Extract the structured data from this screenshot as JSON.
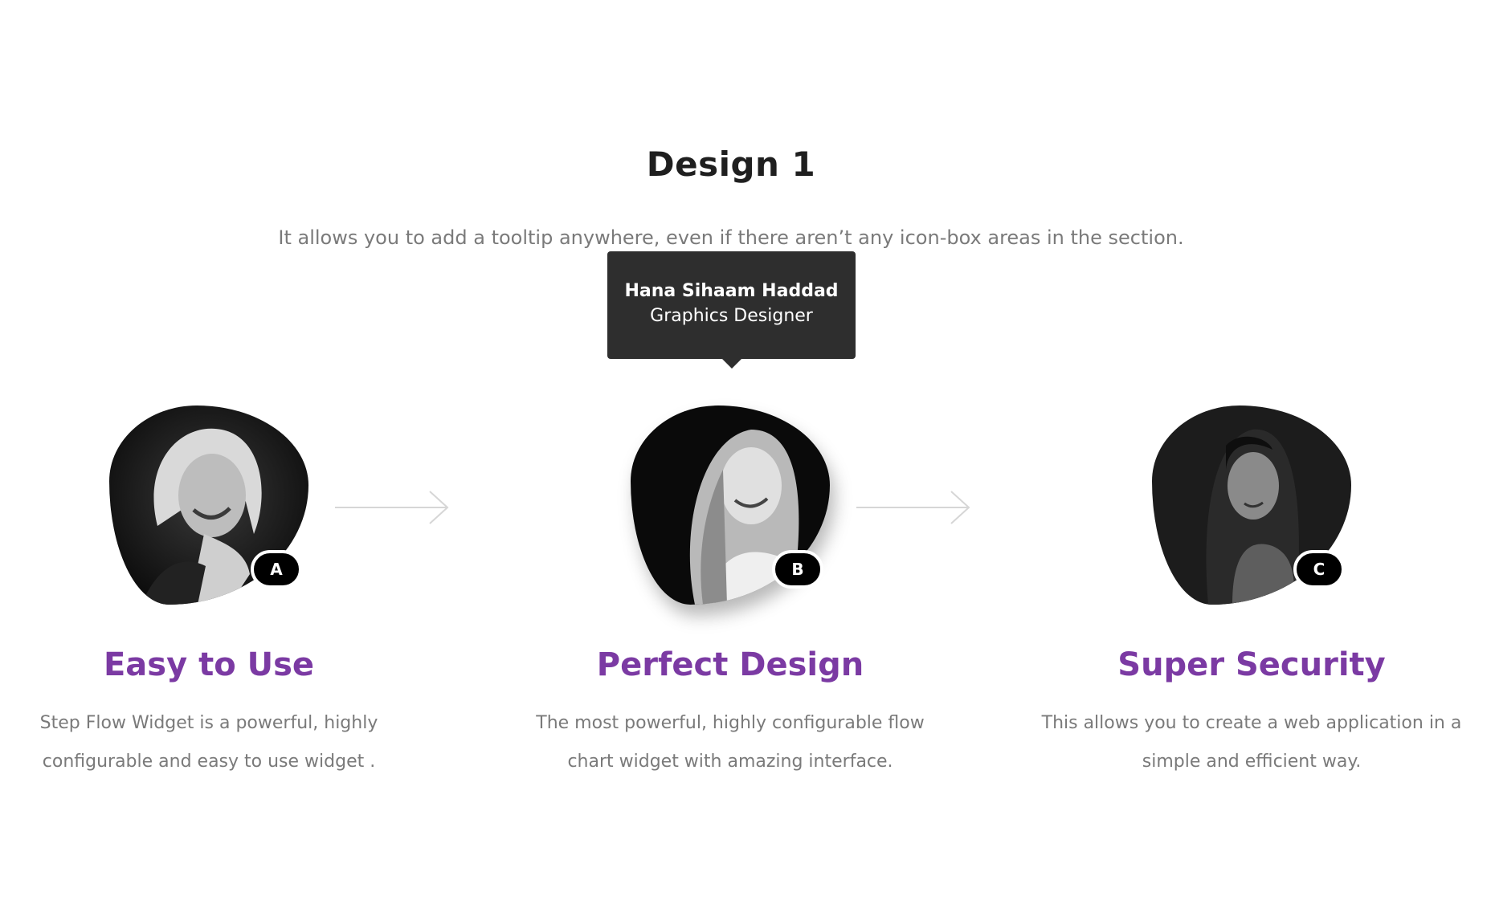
{
  "section": {
    "title": "Design 1",
    "subtitle": "It allows you to add a tooltip anywhere, even if there aren’t any icon-box areas in the section."
  },
  "tooltip": {
    "name": "Hana Sihaam Haddad",
    "role": "Graphics Designer"
  },
  "steps": [
    {
      "badge": "A",
      "title": "Easy to Use",
      "description": "Step Flow Widget is a powerful, highly configurable and easy to use widget ."
    },
    {
      "badge": "B",
      "title": "Perfect Design",
      "description": "The most powerful, highly configurable flow chart widget with amazing interface."
    },
    {
      "badge": "C",
      "title": "Super Security",
      "description": "This allows you to create a web application in a simple and efficient way."
    }
  ],
  "icons": {
    "connector": "arrow-right-icon"
  },
  "colors": {
    "step_title": "#7b3aa3",
    "tooltip_bg": "#2e2e2e",
    "badge_bg": "#000000",
    "body_text": "#7a7a7a",
    "heading": "#1f1f1f"
  }
}
